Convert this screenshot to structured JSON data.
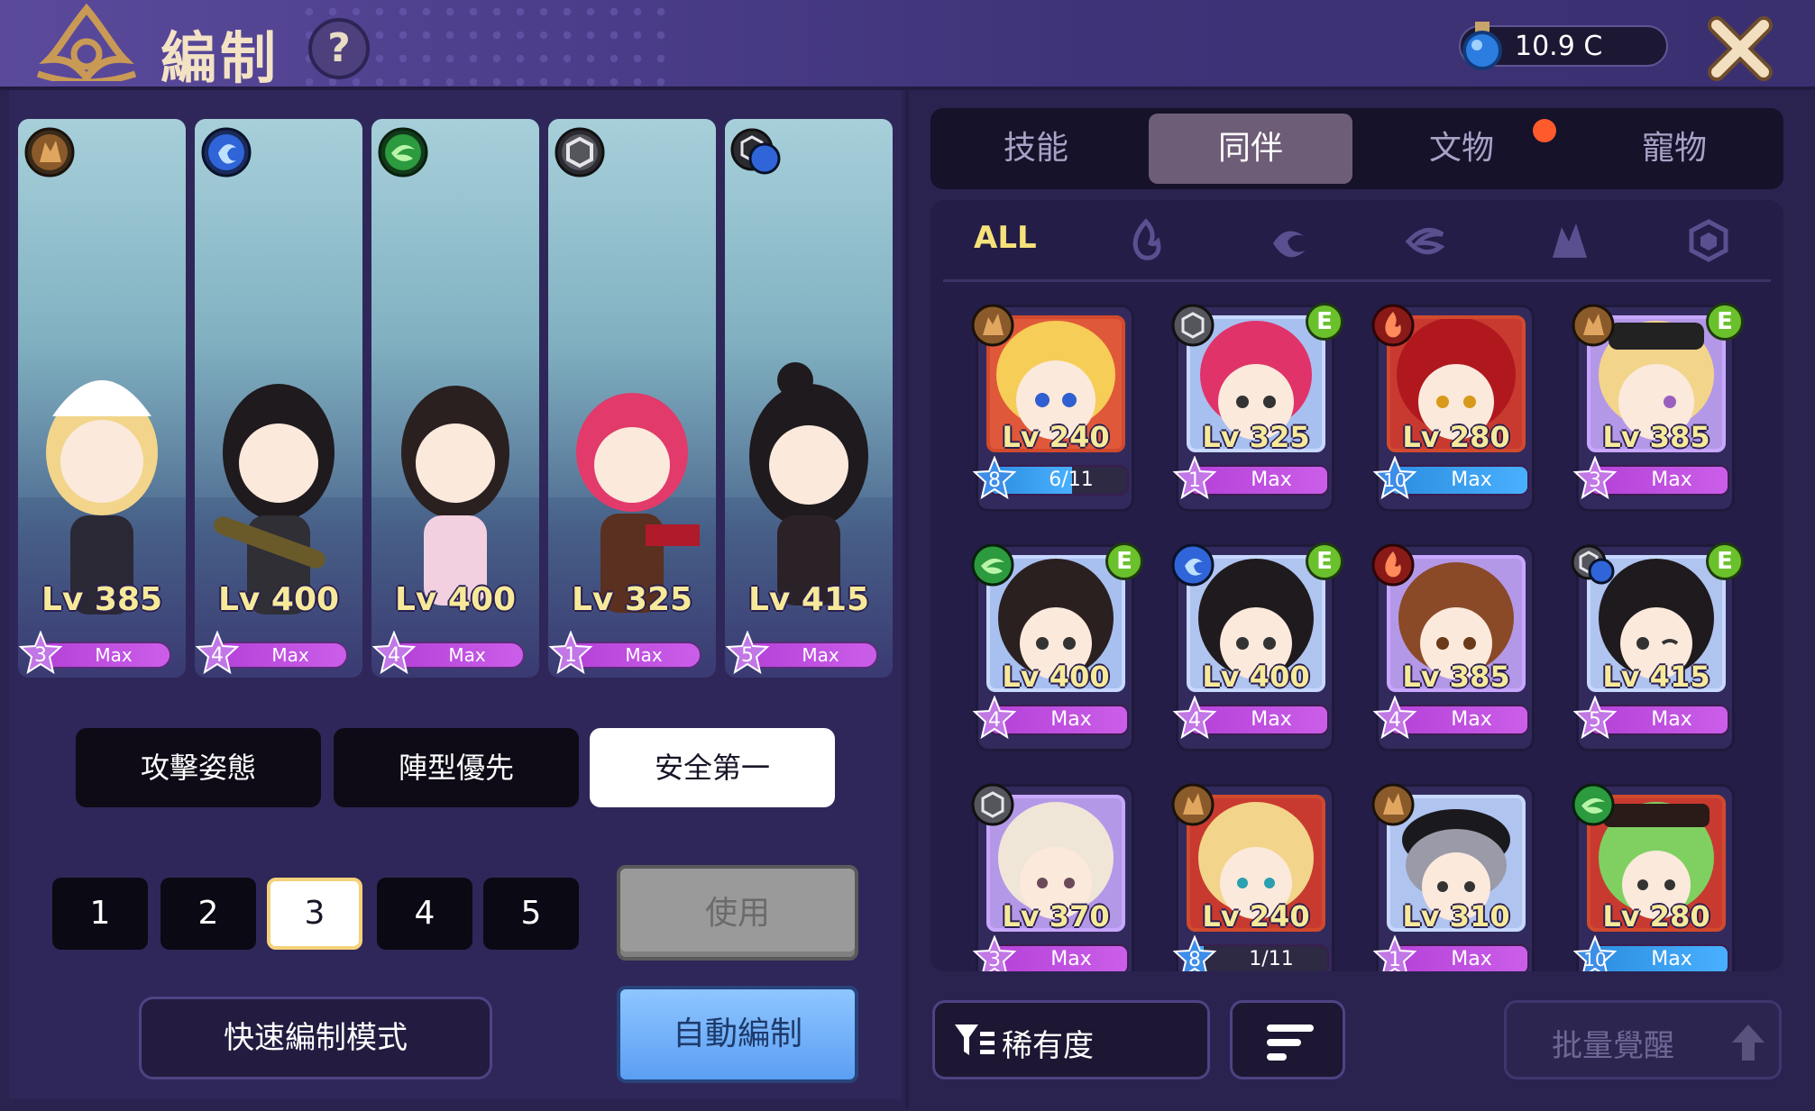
{
  "header": {
    "title": "編制",
    "help_label": "?",
    "currency_value": "10.9 C",
    "currency_icon": "potion-icon",
    "close_icon": "close-icon"
  },
  "team": [
    {
      "level": "Lv 385",
      "stars": "3",
      "bar": "Max",
      "element": "earth"
    },
    {
      "level": "Lv 400",
      "stars": "4",
      "bar": "Max",
      "element": "water"
    },
    {
      "level": "Lv 400",
      "stars": "4",
      "bar": "Max",
      "element": "wind"
    },
    {
      "level": "Lv 325",
      "stars": "1",
      "bar": "Max",
      "element": "neutral"
    },
    {
      "level": "Lv 415",
      "stars": "5",
      "bar": "Max",
      "element": "neutral-water"
    }
  ],
  "stances": [
    "攻擊姿態",
    "陣型優先",
    "安全第一"
  ],
  "active_stance": "安全第一",
  "presets": [
    "1",
    "2",
    "3",
    "4",
    "5"
  ],
  "active_preset": "3",
  "buttons": {
    "use": "使用",
    "quick_mode": "快速編制模式",
    "auto": "自動編制",
    "rarity": "稀有度",
    "batch_awaken": "批量覺醒"
  },
  "tabs": [
    "技能",
    "同伴",
    "文物",
    "寵物"
  ],
  "active_tab": "同伴",
  "filter": {
    "all_label": "ALL",
    "icons": [
      "fire-filter-icon",
      "water-filter-icon",
      "wind-filter-icon",
      "earth-filter-icon",
      "neutral-filter-icon"
    ]
  },
  "roster": [
    {
      "level": "Lv 240",
      "stars": "8",
      "bar": "6/11",
      "element": "earth",
      "e_badge": ""
    },
    {
      "level": "Lv 325",
      "stars": "1",
      "bar": "Max",
      "element": "neutral",
      "e_badge": "E"
    },
    {
      "level": "Lv 280",
      "stars": "10",
      "bar": "Max",
      "element": "fire",
      "e_badge": ""
    },
    {
      "level": "Lv 385",
      "stars": "3",
      "bar": "Max",
      "element": "earth",
      "e_badge": "E"
    },
    {
      "level": "Lv 400",
      "stars": "4",
      "bar": "Max",
      "element": "wind",
      "e_badge": "E"
    },
    {
      "level": "Lv 400",
      "stars": "4",
      "bar": "Max",
      "element": "water",
      "e_badge": "E"
    },
    {
      "level": "Lv 385",
      "stars": "4",
      "bar": "Max",
      "element": "fire",
      "e_badge": ""
    },
    {
      "level": "Lv 415",
      "stars": "5",
      "bar": "Max",
      "element": "neutral-water",
      "e_badge": "E"
    },
    {
      "level": "Lv 370",
      "stars": "3",
      "bar": "Max",
      "element": "neutral",
      "e_badge": ""
    },
    {
      "level": "Lv 240",
      "stars": "8",
      "bar": "1/11",
      "element": "earth",
      "e_badge": ""
    },
    {
      "level": "Lv 310",
      "stars": "1",
      "bar": "Max",
      "element": "earth",
      "e_badge": ""
    },
    {
      "level": "Lv 280",
      "stars": "10",
      "bar": "Max",
      "element": "wind",
      "e_badge": ""
    }
  ],
  "colors": {
    "accent_gold": "#f6e27a",
    "level_text": "#f6ea9a",
    "max_bar": "#cb5ee9",
    "blue_bar": "#49b0ff",
    "auto_button": "#5b9ef3"
  }
}
